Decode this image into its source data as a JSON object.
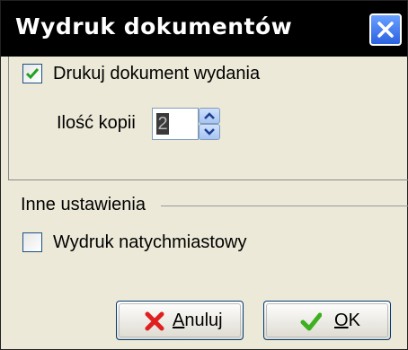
{
  "window": {
    "title": "Wydruk dokumentów",
    "close_icon": "close-icon"
  },
  "print_section": {
    "print_checkbox_label": "Drukuj dokument wydania",
    "print_checked": true,
    "copies_label": "Ilość kopii",
    "copies_value": "2"
  },
  "other_section": {
    "group_label": "Inne ustawienia",
    "immediate_checkbox_label": "Wydruk natychmiastowy",
    "immediate_checked": false
  },
  "buttons": {
    "cancel_label_first": "A",
    "cancel_label_rest": "nuluj",
    "cancel_icon": "red-x-icon",
    "ok_label_first": "O",
    "ok_label_rest": "K",
    "ok_icon": "green-check-icon"
  }
}
